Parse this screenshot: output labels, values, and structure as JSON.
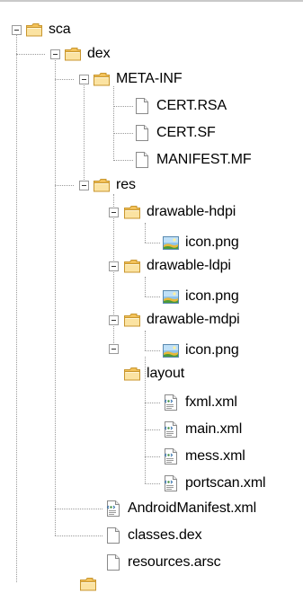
{
  "tree": {
    "sca": "sca",
    "dex": "dex",
    "meta_inf": "META-INF",
    "cert_rsa": "CERT.RSA",
    "cert_sf": "CERT.SF",
    "manifest_mf": "MANIFEST.MF",
    "res": "res",
    "drawable_hdpi": "drawable-hdpi",
    "icon_hdpi": "icon.png",
    "drawable_ldpi": "drawable-ldpi",
    "icon_ldpi": "icon.png",
    "drawable_mdpi": "drawable-mdpi",
    "icon_mdpi": "icon.png",
    "layout": "layout",
    "fxml": "fxml.xml",
    "main": "main.xml",
    "mess": "mess.xml",
    "portscan": "portscan.xml",
    "android_manifest": "AndroidManifest.xml",
    "classes_dex": "classes.dex",
    "resources_arsc": "resources.arsc"
  },
  "icons": {
    "folder": "folder-icon",
    "file": "file-icon",
    "image": "image-icon",
    "xml": "xml-file-icon"
  },
  "colors": {
    "folder_fill": "#f6d27a",
    "folder_edge": "#c8962e",
    "tree_lines": "#9a9a9a"
  }
}
